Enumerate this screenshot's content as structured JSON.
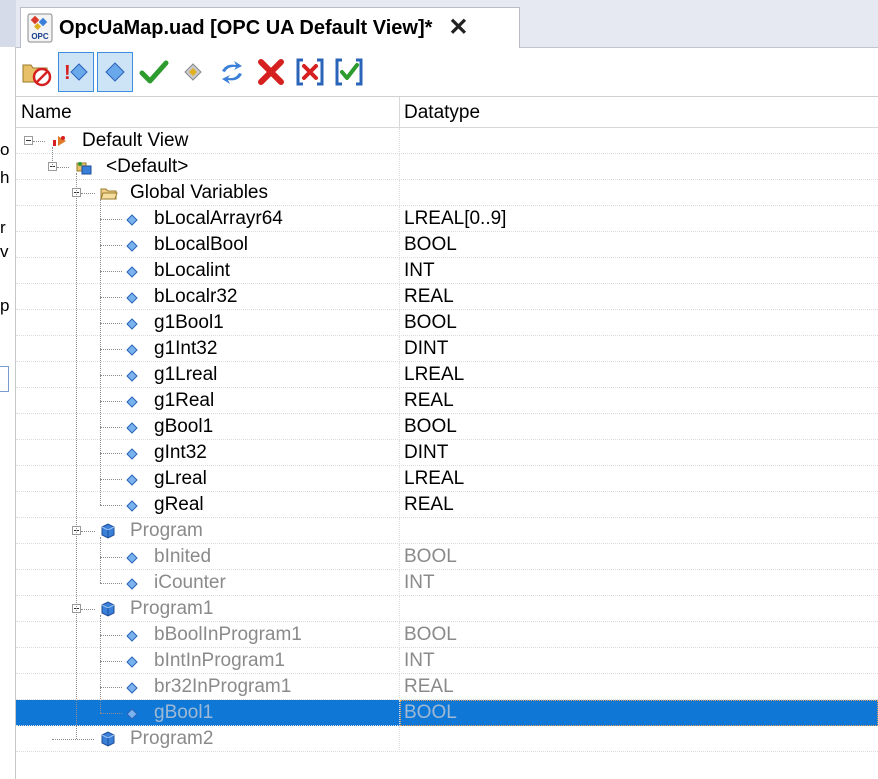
{
  "tab": {
    "title": "OpcUaMap.uad [OPC UA Default View]*",
    "close": "✕",
    "icon": "opc-file-icon",
    "icon_text": "OPC"
  },
  "toolbar": {
    "buttons": [
      {
        "name": "delete-item-button",
        "icon": "folder-no-icon",
        "pressed": false
      },
      {
        "name": "show-warnings-button",
        "icon": "warning-diamond-icon",
        "pressed": true,
        "mark": "!"
      },
      {
        "name": "show-items-button",
        "icon": "diamond-icon",
        "pressed": true
      },
      {
        "name": "check-button",
        "icon": "checkmark-icon",
        "pressed": false
      },
      {
        "name": "refresh-button",
        "icon": "refresh-diamond-icon",
        "pressed": false
      },
      {
        "name": "sync-button",
        "icon": "sync-arrows-icon",
        "pressed": false
      },
      {
        "name": "delete-button",
        "icon": "x-mark-icon",
        "pressed": false
      },
      {
        "name": "uncheck-all-button",
        "icon": "bracket-x-icon",
        "pressed": false
      },
      {
        "name": "check-all-button",
        "icon": "bracket-check-icon",
        "pressed": false
      }
    ]
  },
  "columns": {
    "name": "Name",
    "datatype": "Datatype"
  },
  "rows": [
    {
      "label": "Default View",
      "type": "",
      "level": 0,
      "icon": "view-icon",
      "expander": true,
      "gray": false
    },
    {
      "label": "<Default>",
      "type": "",
      "level": 1,
      "icon": "namespace-icon",
      "expander": true,
      "gray": false
    },
    {
      "label": "Global Variables",
      "type": "",
      "level": 2,
      "icon": "folder-icon",
      "expander": true,
      "gray": false
    },
    {
      "label": "bLocalArrayr64",
      "type": "LREAL[0..9]",
      "level": 3,
      "icon": "variable-icon",
      "gray": false
    },
    {
      "label": "bLocalBool",
      "type": "BOOL",
      "level": 3,
      "icon": "variable-icon",
      "gray": false
    },
    {
      "label": "bLocalint",
      "type": "INT",
      "level": 3,
      "icon": "variable-icon",
      "gray": false
    },
    {
      "label": "bLocalr32",
      "type": "REAL",
      "level": 3,
      "icon": "variable-icon",
      "gray": false
    },
    {
      "label": "g1Bool1",
      "type": "BOOL",
      "level": 3,
      "icon": "variable-icon",
      "gray": false
    },
    {
      "label": "g1Int32",
      "type": "DINT",
      "level": 3,
      "icon": "variable-icon",
      "gray": false
    },
    {
      "label": "g1Lreal",
      "type": "LREAL",
      "level": 3,
      "icon": "variable-icon",
      "gray": false
    },
    {
      "label": "g1Real",
      "type": "REAL",
      "level": 3,
      "icon": "variable-icon",
      "gray": false
    },
    {
      "label": "gBool1",
      "type": "BOOL",
      "level": 3,
      "icon": "variable-icon",
      "gray": false
    },
    {
      "label": "gInt32",
      "type": "DINT",
      "level": 3,
      "icon": "variable-icon",
      "gray": false
    },
    {
      "label": "gLreal",
      "type": "LREAL",
      "level": 3,
      "icon": "variable-icon",
      "gray": false
    },
    {
      "label": "gReal",
      "type": "REAL",
      "level": 3,
      "icon": "variable-icon",
      "gray": false
    },
    {
      "label": "Program",
      "type": "",
      "level": 2,
      "icon": "program-cube-icon",
      "expander": true,
      "gray": true
    },
    {
      "label": "bInited",
      "type": "BOOL",
      "level": 3,
      "icon": "variable-icon",
      "gray": true
    },
    {
      "label": "iCounter",
      "type": "INT",
      "level": 3,
      "icon": "variable-icon",
      "gray": true
    },
    {
      "label": "Program1",
      "type": "",
      "level": 2,
      "icon": "program-cube-icon",
      "expander": true,
      "gray": true
    },
    {
      "label": "bBoolInProgram1",
      "type": "BOOL",
      "level": 3,
      "icon": "variable-icon",
      "gray": true
    },
    {
      "label": "bIntInProgram1",
      "type": "INT",
      "level": 3,
      "icon": "variable-icon",
      "gray": true
    },
    {
      "label": "br32InProgram1",
      "type": "REAL",
      "level": 3,
      "icon": "variable-icon",
      "gray": true
    },
    {
      "label": "gBool1",
      "type": "BOOL",
      "level": 3,
      "icon": "variable-icon",
      "gray": true,
      "selected": true
    },
    {
      "label": "Program2",
      "type": "",
      "level": 2,
      "icon": "program-cube-icon",
      "expander": false,
      "gray": true
    }
  ],
  "background_window": {
    "fragments": [
      "o",
      "h",
      "r",
      "v",
      "p"
    ]
  },
  "colors": {
    "selection": "#0f78d7",
    "gray_text": "#8a8a8a",
    "diamond": "#3a7fd8",
    "check": "#2e9b2e",
    "x": "#d62020"
  }
}
